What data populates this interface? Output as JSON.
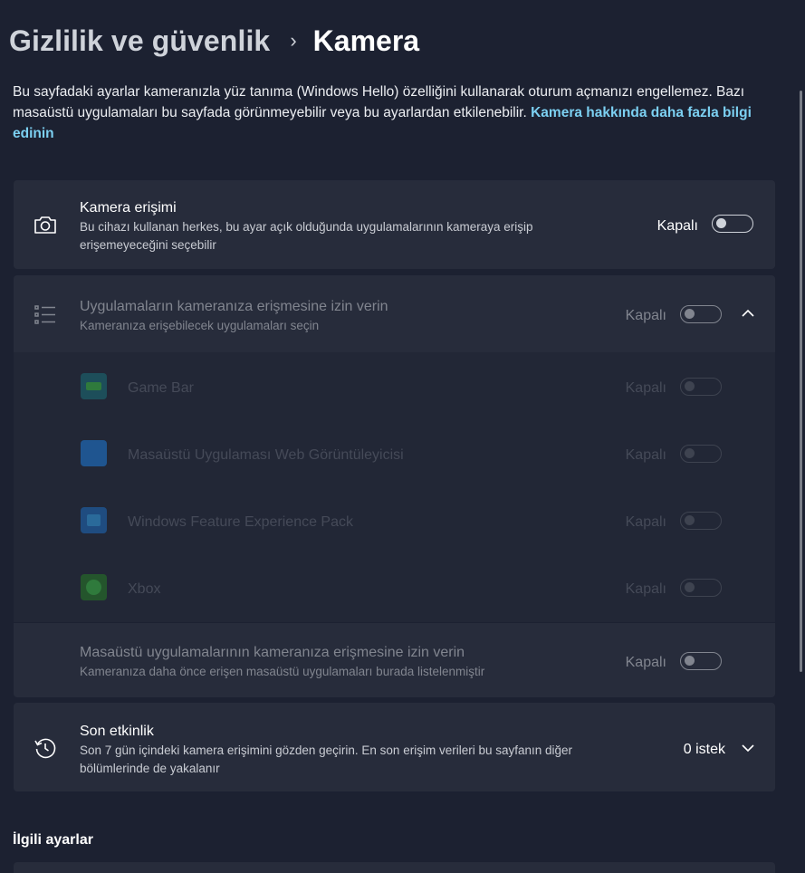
{
  "breadcrumb": {
    "parent": "Gizlilik ve güvenlik",
    "separator": "›",
    "current": "Kamera"
  },
  "description": {
    "text": "Bu sayfadaki ayarlar kameranızla yüz tanıma (Windows Hello) özelliğini kullanarak oturum açmanızı engellemez. Bazı masaüstü uygulamaları bu sayfada görünmeyebilir veya bu ayarlardan etkilenebilir.",
    "link": "Kamera hakkında daha fazla bilgi edinin"
  },
  "camera_access": {
    "icon": "camera-icon",
    "title": "Kamera erişimi",
    "subtitle": "Bu cihazı kullanan herkes, bu ayar açık olduğunda uygulamalarının kameraya erişip erişemeyeceğini seçebilir",
    "state": "Kapalı",
    "toggle_on": false
  },
  "app_access": {
    "icon": "list-icon",
    "title": "Uygulamaların kameranıza erişmesine izin verin",
    "subtitle": "Kameranıza erişebilecek uygulamaları seçin",
    "state": "Kapalı",
    "toggle_on": false,
    "expanded": true,
    "apps": [
      {
        "name": "Game Bar",
        "state": "Kapalı",
        "icon": "game-bar-icon",
        "color": "#1e6b7a"
      },
      {
        "name": "Masaüstü Uygulaması Web Görüntüleyicisi",
        "state": "Kapalı",
        "icon": "web-viewer-icon",
        "color": "#2a6bb0"
      },
      {
        "name": "Windows Feature Experience Pack",
        "state": "Kapalı",
        "icon": "feature-pack-icon",
        "color": "#2a6bb0"
      },
      {
        "name": "Xbox",
        "state": "Kapalı",
        "icon": "xbox-icon",
        "color": "#2a7a3a"
      }
    ]
  },
  "desktop_access": {
    "title": "Masaüstü uygulamalarının kameranıza erişmesine izin verin",
    "subtitle": "Kameranıza daha önce erişen masaüstü uygulamaları burada listelenmiştir",
    "state": "Kapalı",
    "toggle_on": false
  },
  "recent_activity": {
    "icon": "history-icon",
    "title": "Son etkinlik",
    "subtitle": "Son 7 gün içindeki kamera erişimini gözden geçirin. En son erişim verileri bu sayfanın diğer bölümlerinde de yakalanır",
    "value": "0 istek"
  },
  "related": {
    "heading": "İlgili ayarlar"
  },
  "colors": {
    "background": "#1c2131",
    "card": "#272c3b",
    "link": "#7cd0f2"
  }
}
